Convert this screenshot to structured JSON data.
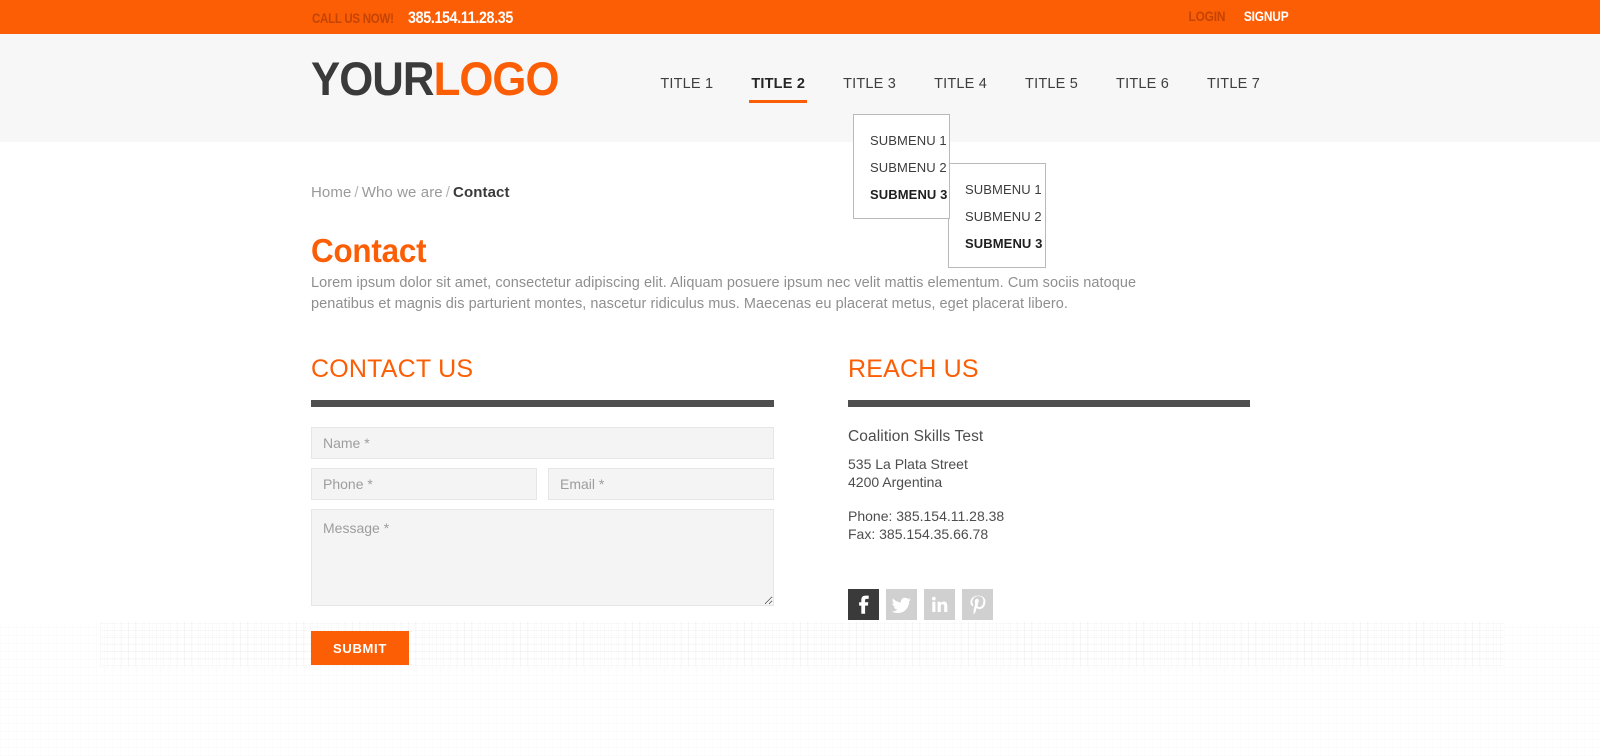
{
  "topbar": {
    "call_label": "CALL US NOW!",
    "phone": "385.154.11.28.35",
    "login": "LOGIN",
    "signup": "SIGNUP",
    "bg_color": "#fc5e05"
  },
  "header": {
    "logo_part1": "YOUR",
    "logo_part2": "LOGO",
    "nav": [
      {
        "label": "TITLE 1",
        "active": false
      },
      {
        "label": "TITLE 2",
        "active": true
      },
      {
        "label": "TITLE 3",
        "active": false
      },
      {
        "label": "TITLE 4",
        "active": false
      },
      {
        "label": "TITLE 5",
        "active": false
      },
      {
        "label": "TITLE 6",
        "active": false
      },
      {
        "label": "TITLE 7",
        "active": false
      }
    ]
  },
  "dropdown_level1": {
    "items": [
      {
        "label": "SUBMENU 1",
        "selected": false
      },
      {
        "label": "SUBMENU 2",
        "selected": false
      },
      {
        "label": "SUBMENU 3",
        "selected": true
      }
    ]
  },
  "dropdown_level2": {
    "items": [
      {
        "label": "SUBMENU 1",
        "selected": false
      },
      {
        "label": "SUBMENU 2",
        "selected": false
      },
      {
        "label": "SUBMENU 3",
        "selected": true
      }
    ]
  },
  "breadcrumb": {
    "home": "Home",
    "sep1": "/",
    "who_we_are": "Who we are",
    "sep2": "/",
    "current": "Contact"
  },
  "page": {
    "title": "Contact",
    "intro": "Lorem ipsum dolor sit amet, consectetur adipiscing elit. Aliquam posuere ipsum nec velit mattis elementum. Cum sociis natoque penatibus et magnis dis parturient montes, nascetur ridiculus mus. Maecenas eu placerat metus, eget placerat libero."
  },
  "contact_form": {
    "heading": "CONTACT US",
    "name_placeholder": "Name *",
    "name_value": "",
    "phone_placeholder": "Phone *",
    "phone_value": "",
    "email_placeholder": "Email *",
    "email_value": "",
    "message_placeholder": "Message *",
    "message_value": "",
    "submit_label": "SUBMIT"
  },
  "reach_us": {
    "heading": "REACH US",
    "org_name": "Coalition Skills Test",
    "address_line1": "535 La Plata Street",
    "address_line2": "4200 Argentina",
    "phone": "Phone: 385.154.11.28.38",
    "fax": "Fax: 385.154.35.66.78",
    "socials": [
      {
        "name": "facebook",
        "label": "f",
        "active": true
      },
      {
        "name": "twitter",
        "label": "t",
        "active": false
      },
      {
        "name": "linkedin",
        "label": "in",
        "active": false
      },
      {
        "name": "pinterest",
        "label": "P",
        "active": false
      }
    ]
  },
  "colors": {
    "accent": "#fc5e05",
    "dark_rule": "#4f4f4f",
    "header_bg": "#f7f7f7",
    "field_bg": "#f4f4f4"
  }
}
